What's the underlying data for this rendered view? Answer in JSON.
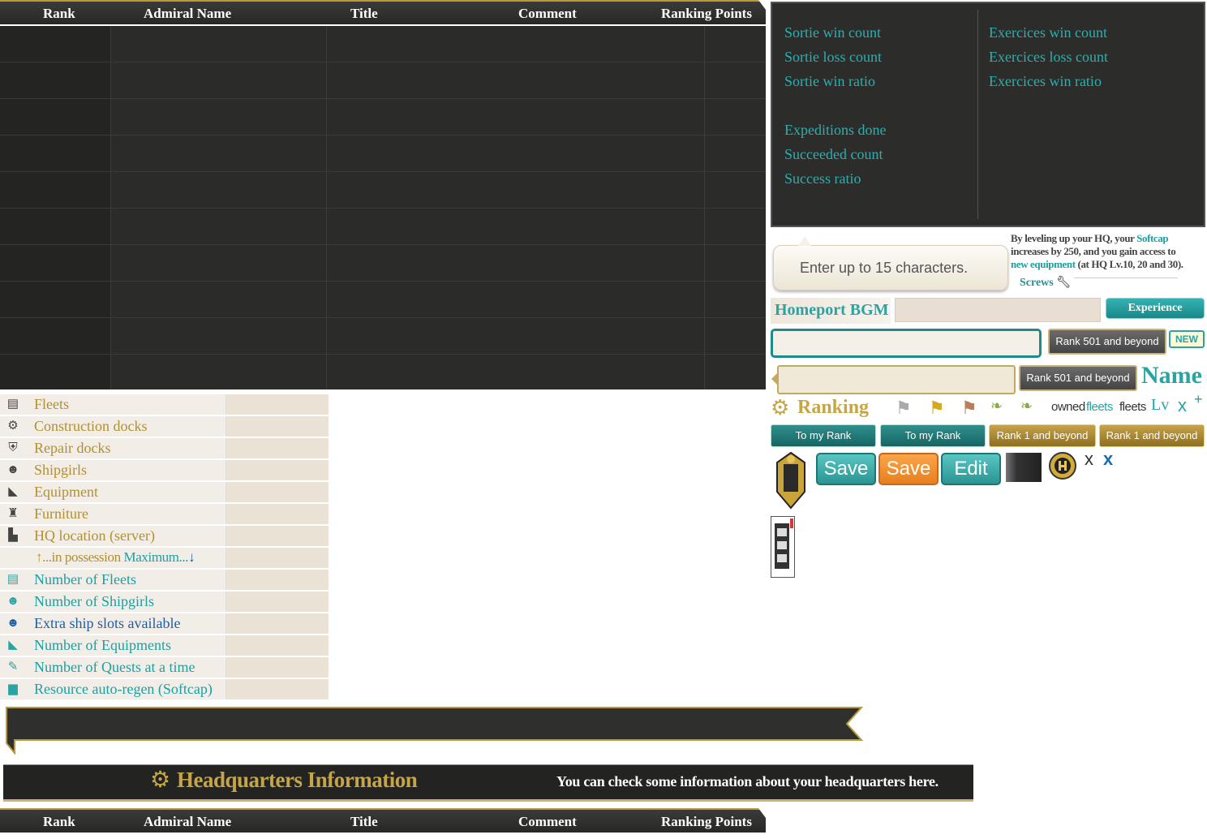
{
  "ranking_header": {
    "rank": "Rank",
    "admiral_name": "Admiral Name",
    "title": "Title",
    "comment": "Comment",
    "ranking_points": "Ranking Points"
  },
  "stats": {
    "left": [
      "Sortie win count",
      "Sortie loss count",
      "Sortie win ratio",
      "Expeditions done",
      "Succeeded count",
      "Success ratio"
    ],
    "right": [
      "Exercices win count",
      "Exercices loss count",
      "Exercices win ratio"
    ]
  },
  "hq_rows": [
    {
      "label": "Fleets",
      "icon": "fleet-icon",
      "glyph": "▤",
      "color": "gold"
    },
    {
      "label": "Construction docks",
      "icon": "gear-icon",
      "glyph": "⚙",
      "color": "gold"
    },
    {
      "label": "Repair docks",
      "icon": "repair-shield-icon",
      "glyph": "⛨",
      "color": "gold"
    },
    {
      "label": "Shipgirls",
      "icon": "shipgirl-icon",
      "glyph": "☻",
      "color": "gold"
    },
    {
      "label": "Equipment",
      "icon": "equipment-icon",
      "glyph": "◣",
      "color": "gold"
    },
    {
      "label": "Furniture",
      "icon": "chair-icon",
      "glyph": "♜",
      "color": "gold"
    },
    {
      "label": "HQ location (server)",
      "icon": "factory-icon",
      "glyph": "▙",
      "color": "gold"
    },
    {
      "label": "Number of Fleets",
      "icon": "fleet-icon",
      "glyph": "▤",
      "color": "teal"
    },
    {
      "label": "Number of Shipgirls",
      "icon": "shipgirl-icon",
      "glyph": "☻",
      "color": "teal"
    },
    {
      "label": "Extra ship slots available",
      "icon": "shipgirl-icon",
      "glyph": "☻",
      "color": "blue"
    },
    {
      "label": "Number of Equipments",
      "icon": "equipment-icon",
      "glyph": "◣",
      "color": "teal"
    },
    {
      "label": "Number of Quests at a time",
      "icon": "quill-icon",
      "glyph": "✎",
      "color": "teal"
    },
    {
      "label": "Resource auto-regen (Softcap)",
      "icon": "book-icon",
      "glyph": "▆",
      "color": "teal"
    }
  ],
  "possession_row": {
    "arrow_up": "↑",
    "text_gold": "...in possession",
    "text_teal": "Maximum...",
    "arrow_down": "↓"
  },
  "chat_bubble": "Enter up to 15 characters.",
  "hq_info_text": {
    "line1_a": "By leveling up your HQ, your ",
    "line1_b": "Softcap",
    "line2": "increases by 250, and you gain access to",
    "line3_a": "new equipment",
    "line3_b": " (at HQ Lv.10, 20 and 30).",
    "screws": "Screws"
  },
  "homeport_bgm": "Homeport BGM",
  "experience": "Experience",
  "rank_501": "Rank 501 and beyond",
  "new_badge": "NEW",
  "name_label": "Name",
  "ranking_title": "Ranking",
  "icons_row": {
    "owned": "owned",
    "fleets_teal": "fleets",
    "fleets_grey": "fleets",
    "lv": "Lv",
    "x": "x",
    "plus": "+"
  },
  "buttons": {
    "to_my_rank": "To my Rank",
    "rank_1": "Rank 1 and beyond",
    "save": "Save",
    "edit": "Edit",
    "x_dark": "x",
    "x_blue": "x"
  },
  "hq_banner": {
    "title": "Headquarters Information",
    "subtitle": "You can check some information about your headquarters here."
  }
}
